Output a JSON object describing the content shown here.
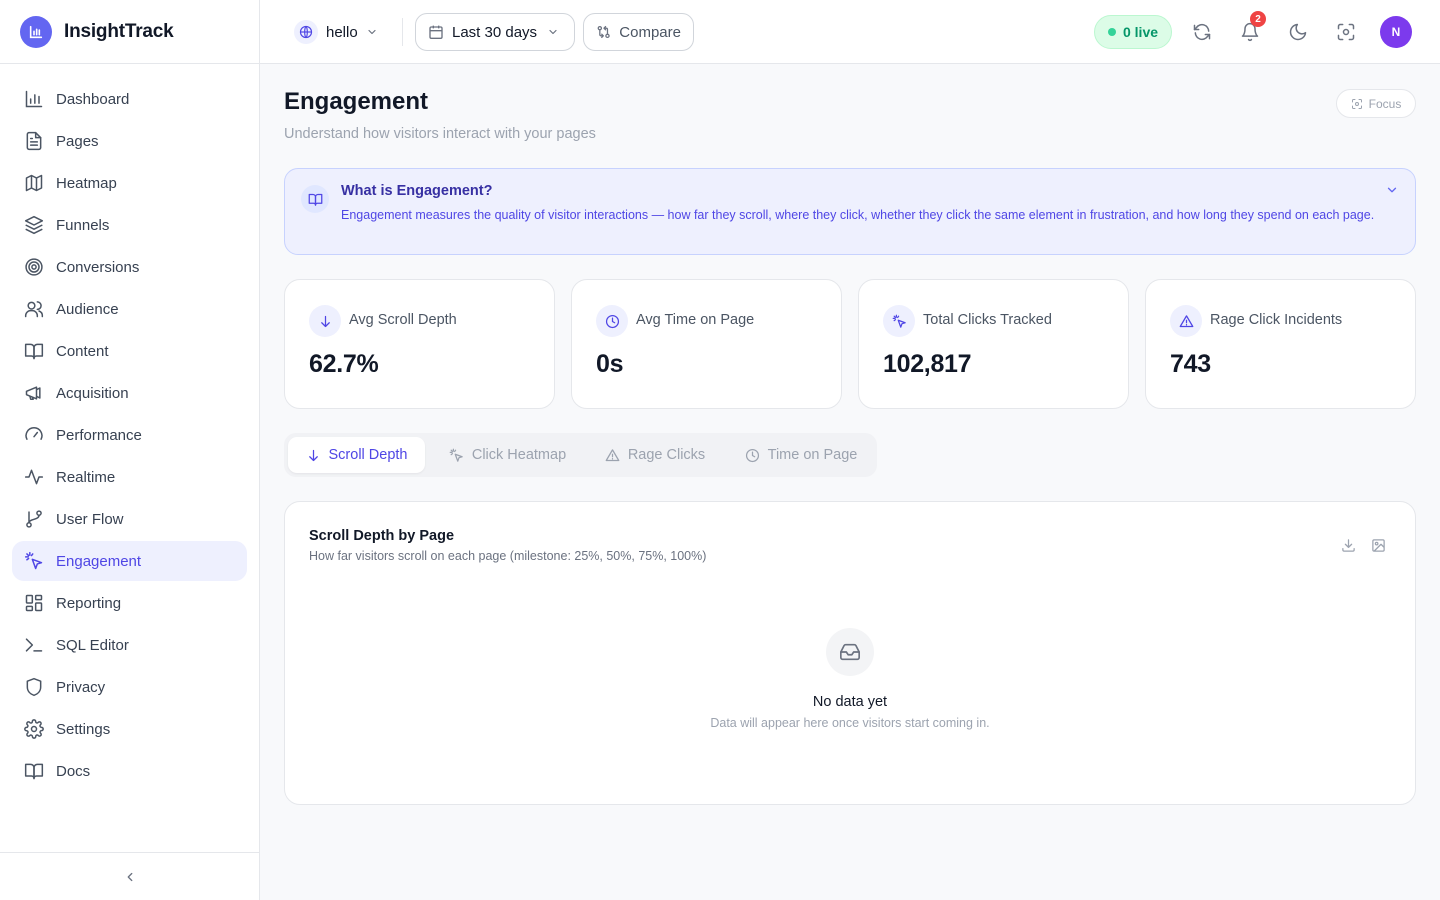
{
  "app": {
    "name": "InsightTrack",
    "brand_color": "#6366f1"
  },
  "sidebar": {
    "items": [
      {
        "label": "Dashboard",
        "icon": "bar-chart-icon"
      },
      {
        "label": "Pages",
        "icon": "file-text-icon"
      },
      {
        "label": "Heatmap",
        "icon": "map-icon"
      },
      {
        "label": "Funnels",
        "icon": "layers-icon"
      },
      {
        "label": "Conversions",
        "icon": "target-icon"
      },
      {
        "label": "Audience",
        "icon": "users-icon"
      },
      {
        "label": "Content",
        "icon": "book-open-icon"
      },
      {
        "label": "Acquisition",
        "icon": "megaphone-icon"
      },
      {
        "label": "Performance",
        "icon": "gauge-icon"
      },
      {
        "label": "Realtime",
        "icon": "activity-icon"
      },
      {
        "label": "User Flow",
        "icon": "git-branch-icon"
      },
      {
        "label": "Engagement",
        "icon": "pointer-click-icon",
        "active": true
      },
      {
        "label": "Reporting",
        "icon": "layout-dashboard-icon"
      },
      {
        "label": "SQL Editor",
        "icon": "terminal-icon"
      },
      {
        "label": "Privacy",
        "icon": "shield-icon"
      },
      {
        "label": "Settings",
        "icon": "gear-icon"
      },
      {
        "label": "Docs",
        "icon": "book-icon"
      }
    ],
    "collapse_icon": "chevron-left-icon"
  },
  "topbar": {
    "site": "hello",
    "date_range": "Last 30 days",
    "compare_label": "Compare",
    "live_label": "0 live",
    "notification_count": "2",
    "avatar_initial": "N"
  },
  "page": {
    "title": "Engagement",
    "subtitle": "Understand how visitors interact with your pages",
    "focus_label": "Focus"
  },
  "info": {
    "title": "What is Engagement?",
    "text": "Engagement measures the quality of visitor interactions — how far they scroll, where they click, whether they click the same element in frustration, and how long they spend on each page."
  },
  "stats": [
    {
      "label": "Avg Scroll Depth",
      "value": "62.7%",
      "icon": "arrow-down-icon"
    },
    {
      "label": "Avg Time on Page",
      "value": "0s",
      "icon": "clock-icon"
    },
    {
      "label": "Total Clicks Tracked",
      "value": "102,817",
      "icon": "pointer-click-icon"
    },
    {
      "label": "Rage Click Incidents",
      "value": "743",
      "icon": "alert-triangle-icon"
    }
  ],
  "tabs": [
    {
      "label": "Scroll Depth",
      "icon": "arrow-down-icon",
      "active": true
    },
    {
      "label": "Click Heatmap",
      "icon": "pointer-click-icon"
    },
    {
      "label": "Rage Clicks",
      "icon": "alert-triangle-icon"
    },
    {
      "label": "Time on Page",
      "icon": "clock-icon"
    }
  ],
  "panel": {
    "title": "Scroll Depth by Page",
    "subtitle": "How far visitors scroll on each page (milestone: 25%, 50%, 75%, 100%)",
    "empty_title": "No data yet",
    "empty_text": "Data will appear here once visitors start coming in."
  }
}
